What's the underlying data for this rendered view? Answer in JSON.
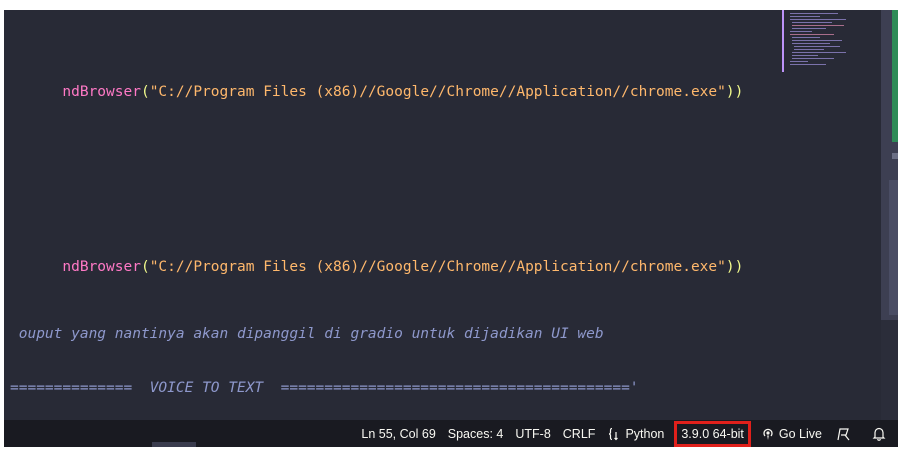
{
  "code_lines": [
    {
      "fn": "ndBrowser",
      "open": "(",
      "string": "\"C://Program Files (x86)//Google//Chrome//Application//chrome.exe\"",
      "close": "))"
    },
    {
      "fn": "ndBrowser",
      "open": "(",
      "string": "\"C://Program Files (x86)//Google//Chrome//Application//chrome.exe\"",
      "close": "))"
    }
  ],
  "comments": [
    " ouput yang nantinya akan dipanggil di gradio untuk dijadikan UI web",
    "==============  VOICE TO TEXT  ========================================'"
  ],
  "statusbar": {
    "position": "Ln 55, Col 69",
    "spaces": "Spaces: 4",
    "encoding": "UTF-8",
    "line_ending": "CRLF",
    "language": "Python",
    "interpreter": "3.9.0 64-bit",
    "go_live": "Go Live"
  },
  "colors": {
    "editor_bg": "#282a36",
    "statusbar_bg": "#191a21",
    "function": "#ff79c6",
    "string": "#ffb86c",
    "comment": "#8e98cc",
    "highlight_border": "#e0201b"
  },
  "icons": {
    "language": "braces-icon",
    "go_live": "broadcast-icon",
    "feedback": "feedback-icon",
    "notifications": "bell-icon"
  }
}
